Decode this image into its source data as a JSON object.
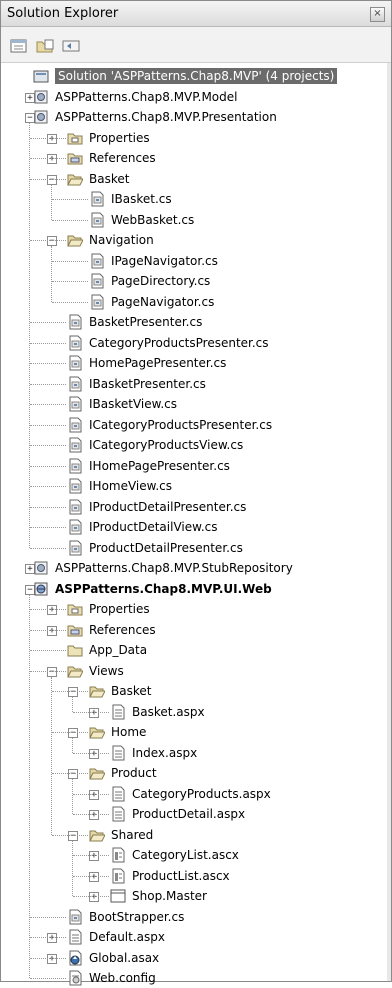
{
  "window": {
    "title": "Solution Explorer",
    "close_glyph": "×"
  },
  "toolbar": {
    "buttons": [
      "properties-icon",
      "show-all-files-icon",
      "refresh-icon"
    ]
  },
  "tree": [
    {
      "label": "Solution 'ASPPatterns.Chap8.MVP' (4 projects)",
      "icon": "solution-icon",
      "level": 0,
      "expander": "none",
      "selected": true
    },
    {
      "label": "ASPPatterns.Chap8.MVP.Model",
      "icon": "project-icon",
      "level": 0,
      "expander": "+"
    },
    {
      "label": "ASPPatterns.Chap8.MVP.Presentation",
      "icon": "project-icon",
      "level": 0,
      "expander": "-"
    },
    {
      "label": "Properties",
      "icon": "properties-folder-icon",
      "level": 1,
      "expander": "+"
    },
    {
      "label": "References",
      "icon": "references-folder-icon",
      "level": 1,
      "expander": "+"
    },
    {
      "label": "Basket",
      "icon": "folder-open-icon",
      "level": 1,
      "expander": "-"
    },
    {
      "label": "IBasket.cs",
      "icon": "cs-file-icon",
      "level": 2,
      "expander": "none"
    },
    {
      "label": "WebBasket.cs",
      "icon": "cs-file-icon",
      "level": 2,
      "expander": "none"
    },
    {
      "label": "Navigation",
      "icon": "folder-open-icon",
      "level": 1,
      "expander": "-"
    },
    {
      "label": "IPageNavigator.cs",
      "icon": "cs-file-icon",
      "level": 2,
      "expander": "none"
    },
    {
      "label": "PageDirectory.cs",
      "icon": "cs-file-icon",
      "level": 2,
      "expander": "none"
    },
    {
      "label": "PageNavigator.cs",
      "icon": "cs-file-icon",
      "level": 2,
      "expander": "none"
    },
    {
      "label": "BasketPresenter.cs",
      "icon": "cs-file-icon",
      "level": 1,
      "expander": "none"
    },
    {
      "label": "CategoryProductsPresenter.cs",
      "icon": "cs-file-icon",
      "level": 1,
      "expander": "none"
    },
    {
      "label": "HomePagePresenter.cs",
      "icon": "cs-file-icon",
      "level": 1,
      "expander": "none"
    },
    {
      "label": "IBasketPresenter.cs",
      "icon": "cs-file-icon",
      "level": 1,
      "expander": "none"
    },
    {
      "label": "IBasketView.cs",
      "icon": "cs-file-icon",
      "level": 1,
      "expander": "none"
    },
    {
      "label": "ICategoryProductsPresenter.cs",
      "icon": "cs-file-icon",
      "level": 1,
      "expander": "none"
    },
    {
      "label": "ICategoryProductsView.cs",
      "icon": "cs-file-icon",
      "level": 1,
      "expander": "none"
    },
    {
      "label": "IHomePagePresenter.cs",
      "icon": "cs-file-icon",
      "level": 1,
      "expander": "none"
    },
    {
      "label": "IHomeView.cs",
      "icon": "cs-file-icon",
      "level": 1,
      "expander": "none"
    },
    {
      "label": "IProductDetailPresenter.cs",
      "icon": "cs-file-icon",
      "level": 1,
      "expander": "none"
    },
    {
      "label": "IProductDetailView.cs",
      "icon": "cs-file-icon",
      "level": 1,
      "expander": "none"
    },
    {
      "label": "ProductDetailPresenter.cs",
      "icon": "cs-file-icon",
      "level": 1,
      "expander": "none"
    },
    {
      "label": "ASPPatterns.Chap8.MVP.StubRepository",
      "icon": "project-icon",
      "level": 0,
      "expander": "+"
    },
    {
      "label": "ASPPatterns.Chap8.MVP.UI.Web",
      "icon": "web-project-icon",
      "level": 0,
      "expander": "-",
      "bold": true
    },
    {
      "label": "Properties",
      "icon": "properties-folder-icon",
      "level": 1,
      "expander": "+"
    },
    {
      "label": "References",
      "icon": "references-folder-icon",
      "level": 1,
      "expander": "+"
    },
    {
      "label": "App_Data",
      "icon": "folder-icon",
      "level": 1,
      "expander": "none"
    },
    {
      "label": "Views",
      "icon": "folder-open-icon",
      "level": 1,
      "expander": "-"
    },
    {
      "label": "Basket",
      "icon": "folder-open-icon",
      "level": 2,
      "expander": "-"
    },
    {
      "label": "Basket.aspx",
      "icon": "aspx-file-icon",
      "level": 3,
      "expander": "+"
    },
    {
      "label": "Home",
      "icon": "folder-open-icon",
      "level": 2,
      "expander": "-"
    },
    {
      "label": "Index.aspx",
      "icon": "aspx-file-icon",
      "level": 3,
      "expander": "+"
    },
    {
      "label": "Product",
      "icon": "folder-open-icon",
      "level": 2,
      "expander": "-"
    },
    {
      "label": "CategoryProducts.aspx",
      "icon": "aspx-file-icon",
      "level": 3,
      "expander": "+"
    },
    {
      "label": "ProductDetail.aspx",
      "icon": "aspx-file-icon",
      "level": 3,
      "expander": "+"
    },
    {
      "label": "Shared",
      "icon": "folder-open-icon",
      "level": 2,
      "expander": "-"
    },
    {
      "label": "CategoryList.ascx",
      "icon": "ascx-file-icon",
      "level": 3,
      "expander": "+"
    },
    {
      "label": "ProductList.ascx",
      "icon": "ascx-file-icon",
      "level": 3,
      "expander": "+"
    },
    {
      "label": "Shop.Master",
      "icon": "master-file-icon",
      "level": 3,
      "expander": "+"
    },
    {
      "label": "BootStrapper.cs",
      "icon": "cs-file-icon",
      "level": 1,
      "expander": "none"
    },
    {
      "label": "Default.aspx",
      "icon": "aspx-file-icon",
      "level": 1,
      "expander": "+"
    },
    {
      "label": "Global.asax",
      "icon": "asax-file-icon",
      "level": 1,
      "expander": "+"
    },
    {
      "label": "Web.config",
      "icon": "config-file-icon",
      "level": 1,
      "expander": "none"
    }
  ]
}
